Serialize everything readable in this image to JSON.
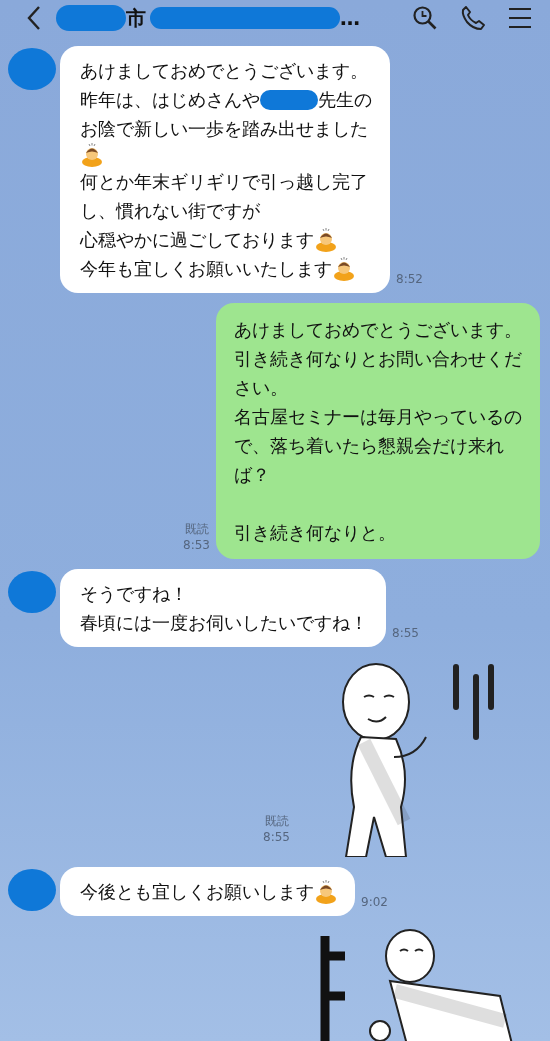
{
  "header": {
    "title": [
      {
        "kind": "redacted"
      },
      {
        "kind": "text",
        "text": "市"
      },
      {
        "kind": "redacted"
      },
      {
        "kind": "text",
        "text": "…"
      }
    ]
  },
  "messages": [
    {
      "kind": "received",
      "time": "8:52",
      "lines": [
        [
          {
            "kind": "text",
            "text": "あけましておめでとうございます。"
          }
        ],
        [
          {
            "kind": "text",
            "text": "昨年は、はじめさんや"
          },
          {
            "kind": "redacted"
          },
          {
            "kind": "text",
            "text": "先生の"
          }
        ],
        [
          {
            "kind": "text",
            "text": "お陰で新しい一歩を踏み出せました"
          }
        ],
        [
          {
            "kind": "emoji"
          }
        ],
        [
          {
            "kind": "text",
            "text": "何とか年末ギリギリで引っ越し完了"
          }
        ],
        [
          {
            "kind": "text",
            "text": "し、慣れない街ですが"
          }
        ],
        [
          {
            "kind": "text",
            "text": "心穏やかに過ごしております"
          },
          {
            "kind": "emoji"
          }
        ],
        [
          {
            "kind": "text",
            "text": "今年も宜しくお願いいたします"
          },
          {
            "kind": "emoji"
          }
        ]
      ]
    },
    {
      "kind": "sent",
      "read": "既読",
      "time": "8:53",
      "paragraphs": [
        [
          [
            {
              "kind": "text",
              "text": "あけましておめでとうございます。"
            }
          ],
          [
            {
              "kind": "text",
              "text": "引き続き何なりとお問い合わせくだ"
            }
          ],
          [
            {
              "kind": "text",
              "text": "さい。"
            }
          ],
          [
            {
              "kind": "text",
              "text": "名古屋セミナーは毎月やっているの"
            }
          ],
          [
            {
              "kind": "text",
              "text": "で、落ち着いたら懇親会だけ来れ"
            }
          ],
          [
            {
              "kind": "text",
              "text": "ば？"
            }
          ]
        ],
        [
          [
            {
              "kind": "text",
              "text": "引き続き何なりと。"
            }
          ]
        ]
      ]
    },
    {
      "kind": "received",
      "time": "8:55",
      "lines": [
        [
          {
            "kind": "text",
            "text": "そうですね！"
          }
        ],
        [
          {
            "kind": "text",
            "text": "春頃には一度お伺いしたいですね！"
          }
        ]
      ]
    },
    {
      "kind": "sticker",
      "read": "既読",
      "time": "8:55"
    },
    {
      "kind": "received",
      "time": "9:02",
      "lines": [
        [
          {
            "kind": "text",
            "text": "今後とも宜しくお願いします"
          },
          {
            "kind": "emoji"
          }
        ]
      ]
    },
    {
      "kind": "sticker_partial"
    }
  ]
}
